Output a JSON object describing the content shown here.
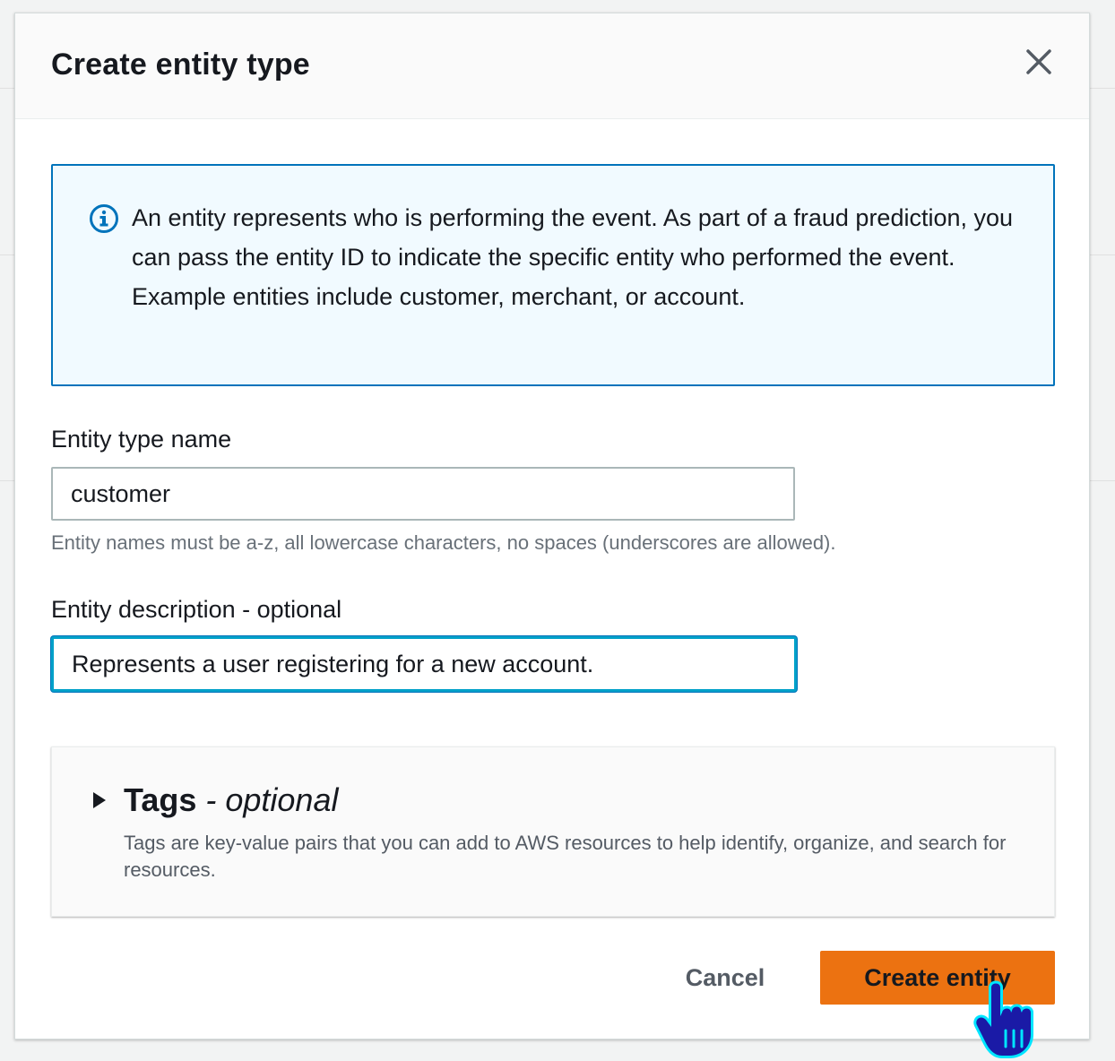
{
  "modal": {
    "title": "Create entity type",
    "close_icon": "close-icon"
  },
  "info": {
    "icon": "info-icon",
    "text": "An entity represents who is performing the event. As part of a fraud prediction, you can pass the entity ID to indicate the specific entity who performed the event. Example entities include customer, merchant, or account."
  },
  "form": {
    "name_label": "Entity type name",
    "name_value": "customer",
    "name_help": "Entity names must be a-z, all lowercase characters, no spaces (underscores are allowed).",
    "description_label": "Entity description - optional",
    "description_value": "Represents a user registering for a new account."
  },
  "tags": {
    "caret_icon": "caret-right-icon",
    "heading": "Tags",
    "heading_separator": " - ",
    "heading_optional": "optional",
    "description": "Tags are key-value pairs that you can add to AWS resources to help identify, organize, and search for resources."
  },
  "footer": {
    "cancel_label": "Cancel",
    "create_label": "Create entity"
  },
  "colors": {
    "primary_button": "#ec7211",
    "info_border": "#0073bb",
    "info_background": "#f1faff",
    "focus_ring": "#00a1c9"
  },
  "cursor": {
    "icon": "hand-pointer-icon"
  }
}
